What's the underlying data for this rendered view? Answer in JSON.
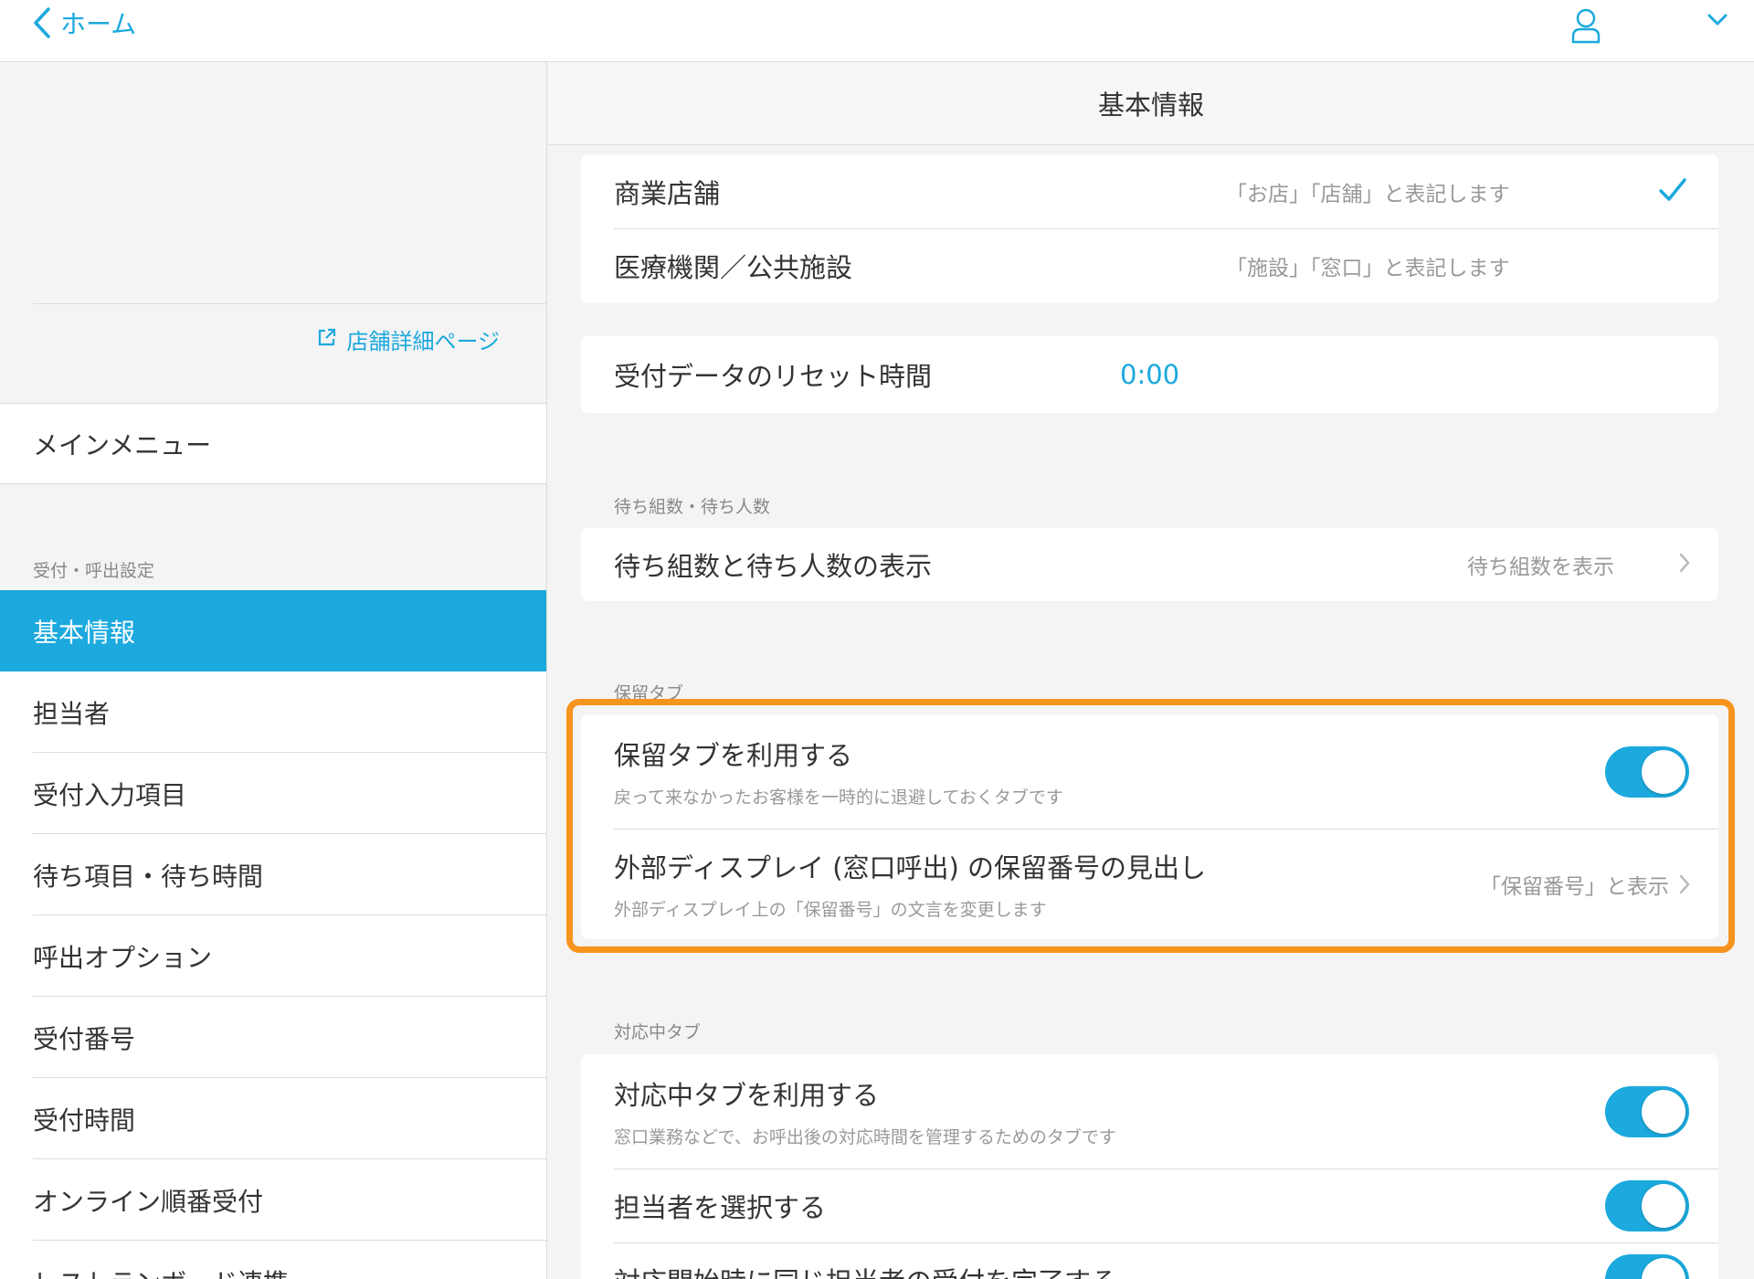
{
  "topbar": {
    "back_label": "ホーム",
    "back_icon": "chevron-left-icon",
    "user_icon": "user-icon",
    "menu_icon": "chevron-down-icon"
  },
  "sidebar": {
    "store_link": "店舗詳細ページ",
    "main_menu": "メインメニュー",
    "section_label": "受付・呼出設定",
    "items": [
      {
        "label": "基本情報",
        "active": true
      },
      {
        "label": "担当者"
      },
      {
        "label": "受付入力項目"
      },
      {
        "label": "待ち項目・待ち時間"
      },
      {
        "label": "呼出オプション"
      },
      {
        "label": "受付番号"
      },
      {
        "label": "受付時間"
      },
      {
        "label": "オンライン順番受付"
      },
      {
        "label": "レストランボード連携"
      }
    ]
  },
  "main": {
    "title": "基本情報",
    "business_type": [
      {
        "label": "商業店舗",
        "value": "「お店」「店舗」と表記します",
        "checked": true
      },
      {
        "label": "医療機関／公共施設",
        "value": "「施設」「窓口」と表記します",
        "checked": false
      }
    ],
    "reset": {
      "label": "受付データのリセット時間",
      "value": "0:00"
    },
    "wait_section": {
      "label": "待ち組数・待ち人数",
      "row_label": "待ち組数と待ち人数の表示",
      "row_value": "待ち組数を表示"
    },
    "hold_section": {
      "label": "保留タブ",
      "use_label": "保留タブを利用する",
      "use_desc": "戻って来なかったお客様を一時的に退避しておくタブです",
      "use_on": true,
      "heading_label": "外部ディスプレイ (窓口呼出) の保留番号の見出し",
      "heading_desc": "外部ディスプレイ上の「保留番号」の文言を変更します",
      "heading_value": "「保留番号」と表示"
    },
    "active_section": {
      "label": "対応中タブ",
      "use_label": "対応中タブを利用する",
      "use_desc": "窓口業務などで、お呼出後の対応時間を管理するためのタブです",
      "use_on": true,
      "staff_label": "担当者を選択する",
      "staff_on": true,
      "complete_label": "対応開始時に同じ担当者の受付を完了する",
      "complete_on": true
    }
  },
  "colors": {
    "accent": "#1ba9de",
    "highlight": "#f7941d"
  }
}
